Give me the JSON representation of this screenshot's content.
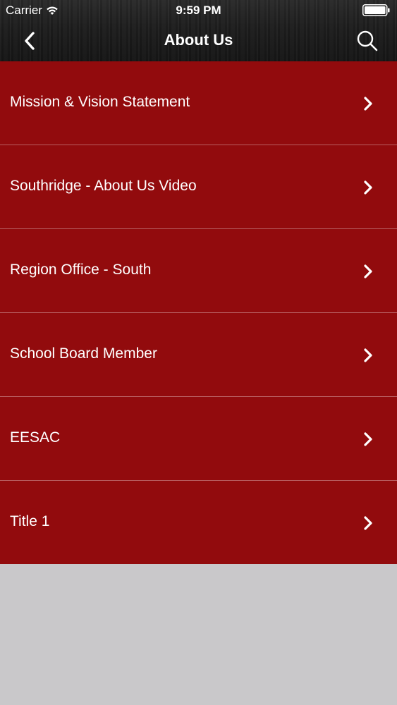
{
  "status_bar": {
    "carrier": "Carrier",
    "time": "9:59 PM"
  },
  "nav": {
    "title": "About Us",
    "back_icon": "chevron-left-icon",
    "search_icon": "search-icon"
  },
  "menu": {
    "items": [
      {
        "label": "Mission & Vision Statement"
      },
      {
        "label": "Southridge - About Us Video"
      },
      {
        "label": "Region Office - South"
      },
      {
        "label": "School Board Member"
      },
      {
        "label": "EESAC"
      },
      {
        "label": "Title 1"
      }
    ]
  },
  "colors": {
    "list_background": "#920b0d",
    "divider": "#b86062",
    "page_background": "#c9c8ca",
    "header_background": "#1e1e1e",
    "text": "#ffffff"
  }
}
